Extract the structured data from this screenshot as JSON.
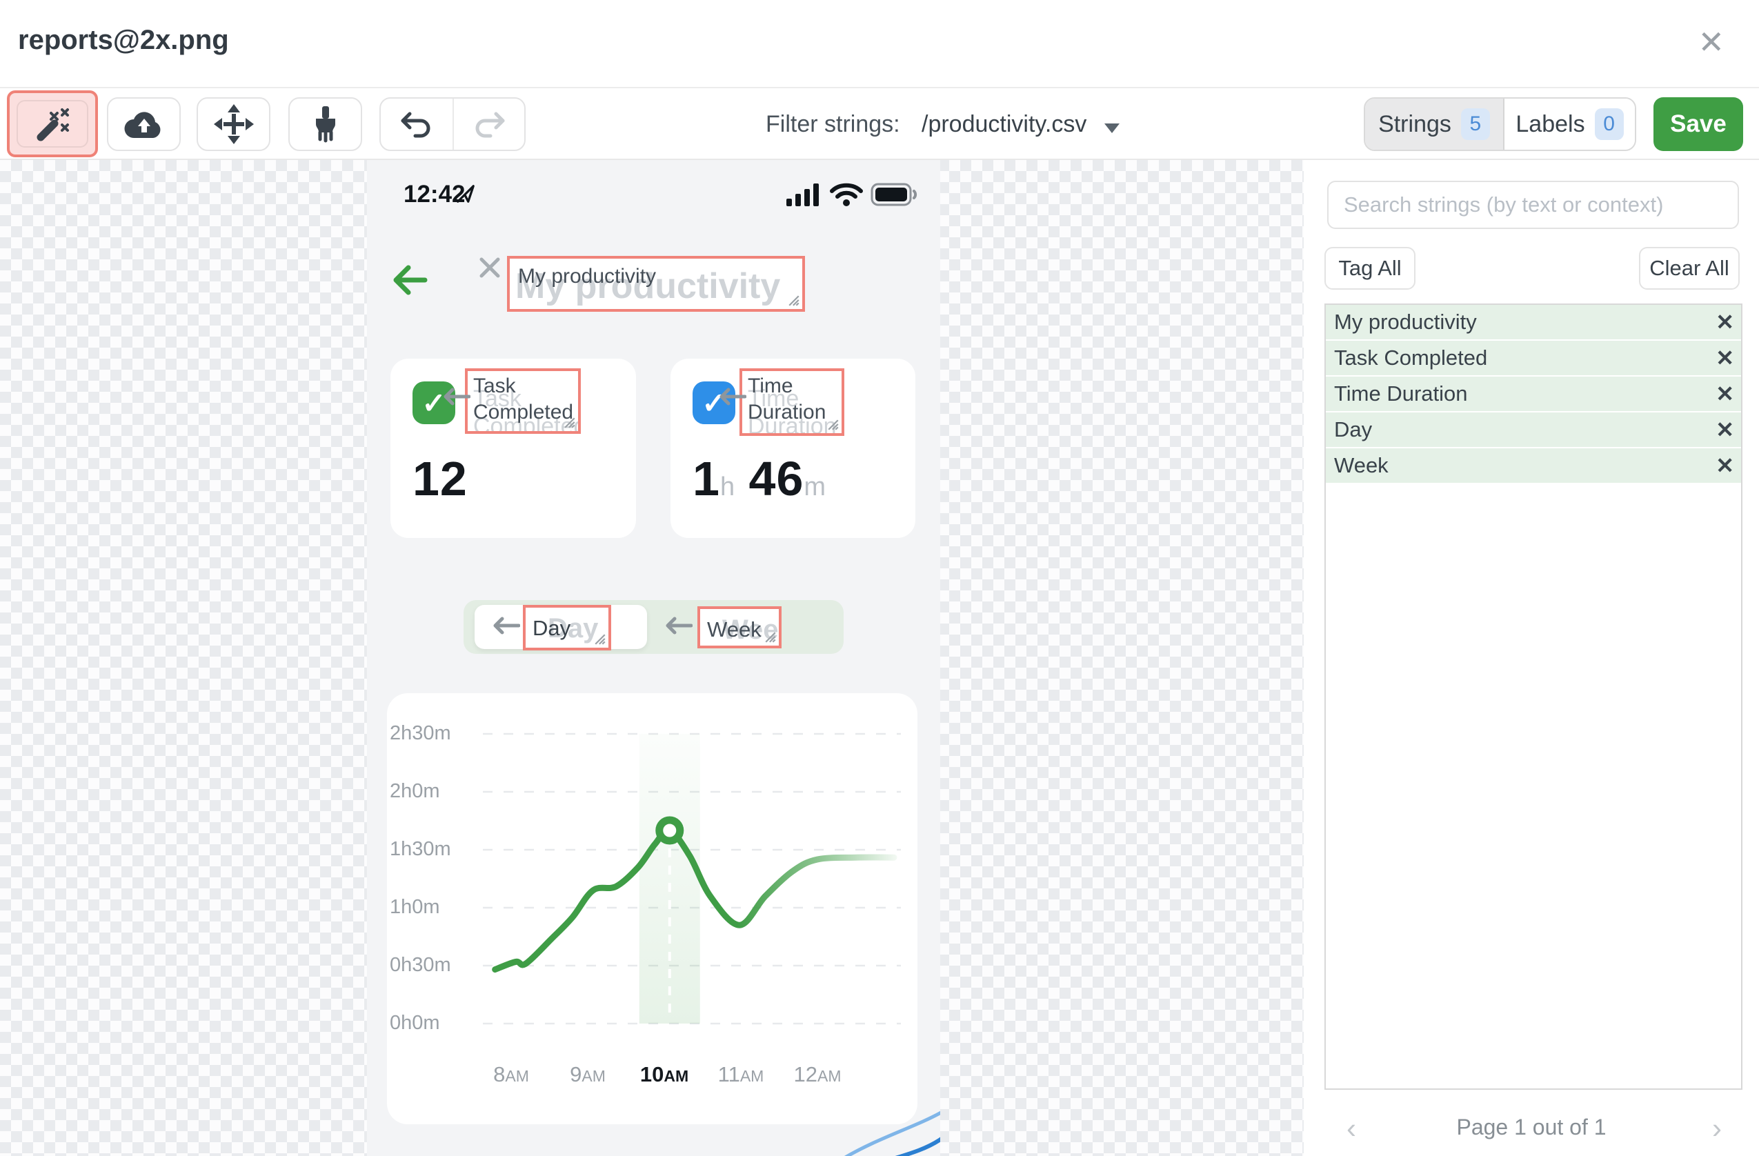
{
  "window": {
    "title": "reports@2x.png",
    "close_icon": "✕"
  },
  "toolbar": {
    "filter_label": "Filter strings:",
    "filter_value": "/productivity.csv",
    "strings_tab": {
      "label": "Strings",
      "count": "5"
    },
    "labels_tab": {
      "label": "Labels",
      "count": "0"
    },
    "save_label": "Save"
  },
  "phone": {
    "status_time": "12:42",
    "nav_title": "My productivity",
    "cards": [
      {
        "label": "Task Completed",
        "value": "12"
      },
      {
        "label": "Time Duration",
        "hours": "1",
        "hours_unit": "h",
        "minutes": "46",
        "minutes_unit": "m"
      }
    ],
    "toggle": {
      "day": "Day",
      "week": "Week"
    }
  },
  "chart_data": {
    "type": "line",
    "title": "",
    "xlabel": "",
    "ylabel": "",
    "x_tick_labels": [
      "8AM",
      "9AM",
      "10AM",
      "11AM",
      "12AM"
    ],
    "selected_tick": "10AM",
    "y_tick_labels": [
      "0h0m",
      "0h30m",
      "1h0m",
      "1h30m",
      "2h0m",
      "2h30m"
    ],
    "ylim_minutes": [
      0,
      150
    ],
    "grid": "horizontal-dashed",
    "legend": "none",
    "line_color": "#3f9d46",
    "series": [
      {
        "name": "Time Duration",
        "points_hour_minutes": [
          [
            7.79,
            28
          ],
          [
            8.06,
            32
          ],
          [
            8.19,
            31
          ],
          [
            8.53,
            44
          ],
          [
            8.8,
            55
          ],
          [
            9.07,
            69
          ],
          [
            9.37,
            71
          ],
          [
            9.66,
            81
          ],
          [
            9.88,
            93
          ],
          [
            10.07,
            100
          ],
          [
            10.33,
            87
          ],
          [
            10.6,
            66
          ],
          [
            10.98,
            51
          ],
          [
            11.32,
            66
          ],
          [
            11.68,
            79
          ],
          [
            12.0,
            85
          ],
          [
            12.5,
            86
          ],
          [
            13.0,
            86
          ]
        ]
      }
    ],
    "highlight_point": {
      "hour": 10.07,
      "minutes": 100,
      "value_label": "1h 46m"
    }
  },
  "sidebar": {
    "search_placeholder": "Search strings (by text or context)",
    "tag_all_label": "Tag All",
    "clear_all_label": "Clear All",
    "strings": [
      "My productivity",
      "Task Completed",
      "Time Duration",
      "Day",
      "Week"
    ],
    "remove_icon": "✕",
    "pagination": {
      "label": "Page 1 out of 1",
      "prev_icon": "‹",
      "next_icon": "›"
    }
  },
  "colors": {
    "accent_green": "#3f9d46",
    "tag_red_border": "#f0837a",
    "save_green": "#3f9e44",
    "badge_blue": "#4b8bd5",
    "task_icon_green": "#3fa24a",
    "time_icon_blue": "#2e8fe8",
    "row_green": "#e5f1e7"
  }
}
